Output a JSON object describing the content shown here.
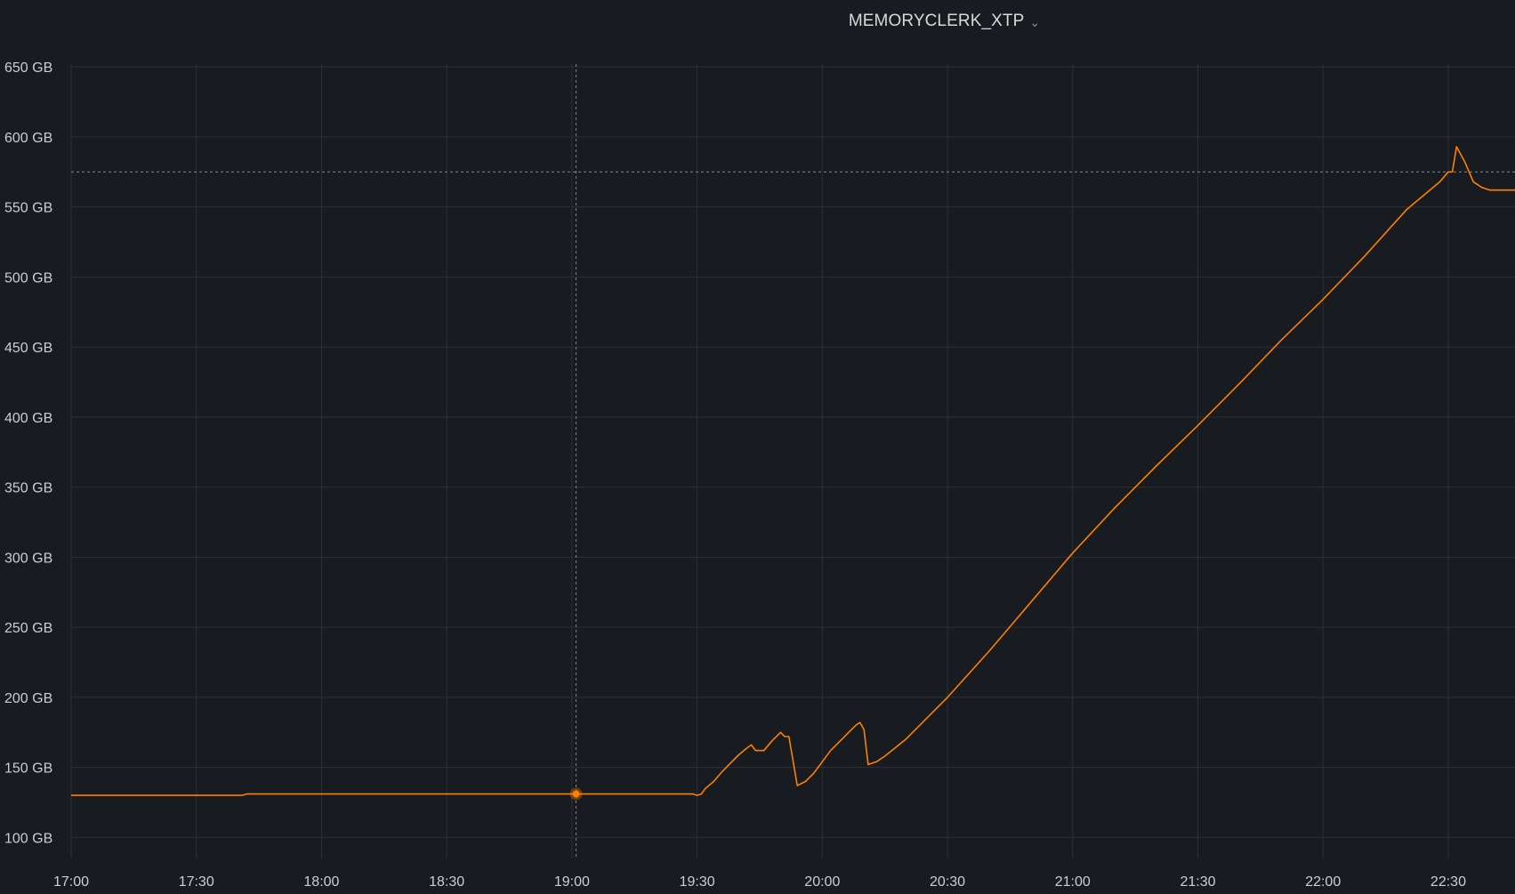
{
  "panel": {
    "title": "MEMORYCLERK_XTP",
    "menu_icon": "chevron-down-icon"
  },
  "colors": {
    "background": "#181b1f",
    "series": "#ff7f00",
    "grid": "#2c3036",
    "text": "#ccccdc"
  },
  "chart_data": {
    "type": "line",
    "title": "MEMORYCLERK_XTP",
    "xlabel": "",
    "ylabel": "",
    "grid": true,
    "x_ticks": [
      "17:00",
      "17:30",
      "18:00",
      "18:30",
      "19:00",
      "19:30",
      "20:00",
      "20:30",
      "21:00",
      "21:30",
      "22:00",
      "22:30"
    ],
    "y_ticks": [
      "100 GB",
      "150 GB",
      "200 GB",
      "250 GB",
      "300 GB",
      "350 GB",
      "400 GB",
      "450 GB",
      "500 GB",
      "550 GB",
      "600 GB",
      "650 GB"
    ],
    "xlim": [
      "17:00",
      "22:46"
    ],
    "ylim": [
      85,
      652
    ],
    "y_unit": "GB",
    "series": [
      {
        "color": "#ff7f00",
        "points": [
          [
            "17:00",
            130
          ],
          [
            "17:41",
            130
          ],
          [
            "17:42",
            131
          ],
          [
            "19:29",
            131
          ],
          [
            "19:30",
            130
          ],
          [
            "19:31",
            131
          ],
          [
            "19:32",
            135
          ],
          [
            "19:34",
            140
          ],
          [
            "19:36",
            147
          ],
          [
            "19:38",
            153
          ],
          [
            "19:40",
            159
          ],
          [
            "19:42",
            164
          ],
          [
            "19:43",
            166
          ],
          [
            "19:44",
            162
          ],
          [
            "19:46",
            162
          ],
          [
            "19:48",
            169
          ],
          [
            "19:50",
            175
          ],
          [
            "19:51",
            172
          ],
          [
            "19:52",
            172
          ],
          [
            "19:54",
            137
          ],
          [
            "19:56",
            140
          ],
          [
            "19:58",
            146
          ],
          [
            "20:00",
            154
          ],
          [
            "20:02",
            162
          ],
          [
            "20:04",
            168
          ],
          [
            "20:06",
            174
          ],
          [
            "20:08",
            180
          ],
          [
            "20:09",
            182
          ],
          [
            "20:10",
            177
          ],
          [
            "20:11",
            152
          ],
          [
            "20:13",
            154
          ],
          [
            "20:15",
            158
          ],
          [
            "20:20",
            170
          ],
          [
            "20:30",
            200
          ],
          [
            "20:40",
            233
          ],
          [
            "20:50",
            268
          ],
          [
            "21:00",
            303
          ],
          [
            "21:10",
            335
          ],
          [
            "21:20",
            365
          ],
          [
            "21:30",
            394
          ],
          [
            "21:40",
            424
          ],
          [
            "21:50",
            455
          ],
          [
            "22:00",
            484
          ],
          [
            "22:10",
            515
          ],
          [
            "22:20",
            548
          ],
          [
            "22:28",
            568
          ],
          [
            "22:30",
            575
          ],
          [
            "22:31",
            575
          ],
          [
            "22:32",
            593
          ],
          [
            "22:34",
            582
          ],
          [
            "22:36",
            568
          ],
          [
            "22:38",
            564
          ],
          [
            "22:40",
            562
          ],
          [
            "22:46",
            562
          ]
        ]
      }
    ],
    "crosshair": {
      "x": "19:01",
      "y": 575,
      "value": 131
    }
  }
}
